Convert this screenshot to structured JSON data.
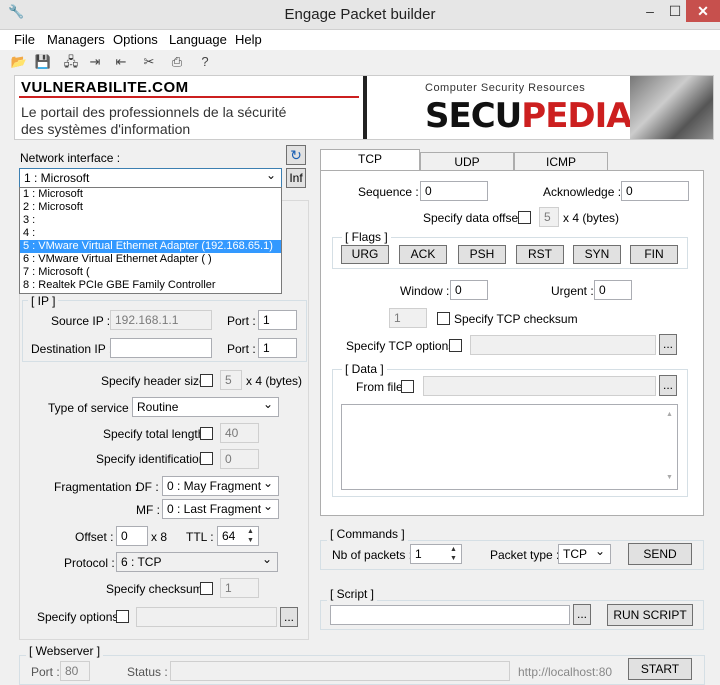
{
  "window": {
    "title": "Engage Packet builder",
    "minimize": "–",
    "maximize": "☐",
    "close": "✕",
    "app_icon": "🔧"
  },
  "menu": [
    "File",
    "Managers",
    "Options",
    "Language",
    "Help"
  ],
  "toolbar_icons": [
    "open-icon",
    "save-icon",
    "network-icon",
    "import-icon",
    "export-icon",
    "tools-icon",
    "print-icon",
    "help-icon"
  ],
  "banner": {
    "left_brand": "VULNERABILITE.COM",
    "left_tagline_1": "Le portail des professionnels de la sécurité",
    "left_tagline_2": "des systèmes d'information",
    "right_caption": "Computer Security Resources",
    "right_brand_a": "SECU",
    "right_brand_b": "PEDIA"
  },
  "network": {
    "label": "Network interface :",
    "selected": "1 :  Microsoft",
    "info_btn": "Inf",
    "options": [
      "1 :  Microsoft",
      "2 :  Microsoft",
      "3 :",
      "4 :",
      "5 :  VMware Virtual Ethernet Adapter  (192.168.65.1)",
      "6 :  VMware Virtual Ethernet Adapter  (                        )",
      "7 :  Microsoft  (",
      "8 :  Realtek PCIe GBE Family Controller"
    ]
  },
  "ip": {
    "group_title": "[ IP ]",
    "source_label": "Source IP :",
    "source_value": "192.168.1.1",
    "source_port_label": "Port :",
    "source_port": "1",
    "dest_label": "Destination IP :",
    "dest_value": "",
    "dest_port_label": "Port :",
    "dest_port": "1",
    "header_size_label": "Specify header size",
    "header_size_value": "5",
    "header_size_unit": "x 4 (bytes)",
    "tos_label": "Type of service :",
    "tos_value": "Routine",
    "total_length_label": "Specify total length",
    "total_length_value": "40",
    "identification_label": "Specify identification",
    "identification_value": "0",
    "fragmentation_label": "Fragmentation :",
    "df_label": "DF :",
    "df_value": "0 : May Fragment",
    "mf_label": "MF :",
    "mf_value": "0 : Last Fragment",
    "offset_label": "Offset :",
    "offset_value": "0",
    "offset_unit": "x 8",
    "ttl_label": "TTL :",
    "ttl_value": "64",
    "protocol_label": "Protocol :",
    "protocol_value": "6 : TCP",
    "checksum_label": "Specify checksum",
    "checksum_value": "1",
    "options_label": "Specify options",
    "browse": "..."
  },
  "webserver": {
    "group_title": "[ Webserver ]",
    "port_label": "Port :",
    "port_value": "80",
    "status_label": "Status :",
    "url": "http://localhost:80",
    "start": "START"
  },
  "tabs": [
    "TCP",
    "UDP",
    "ICMP"
  ],
  "tcp": {
    "sequence_label": "Sequence :",
    "sequence_value": "0",
    "ack_label": "Acknowledge :",
    "ack_value": "0",
    "data_offset_label": "Specify data offset",
    "data_offset_value": "5",
    "data_offset_unit": "x 4 (bytes)",
    "flags_title": "[ Flags ]",
    "flags": [
      "URG",
      "ACK",
      "PSH",
      "RST",
      "SYN",
      "FIN"
    ],
    "window_label": "Window :",
    "window_value": "0",
    "urgent_label": "Urgent :",
    "urgent_value": "0",
    "checksum_value": "1",
    "checksum_label": "Specify TCP checksum",
    "options_label": "Specify TCP options",
    "data_title": "[ Data ]",
    "from_file_label": "From file"
  },
  "commands": {
    "group_title": "[ Commands ]",
    "nb_label": "Nb of packets :",
    "nb_value": "1",
    "type_label": "Packet type :",
    "type_value": "TCP",
    "send": "SEND"
  },
  "script": {
    "group_title": "[ Script ]",
    "value": "",
    "run": "RUN SCRIPT"
  },
  "colors": {
    "selection": "#3399ff",
    "close": "#c7504d",
    "brand_red": "#cc1f1f"
  }
}
